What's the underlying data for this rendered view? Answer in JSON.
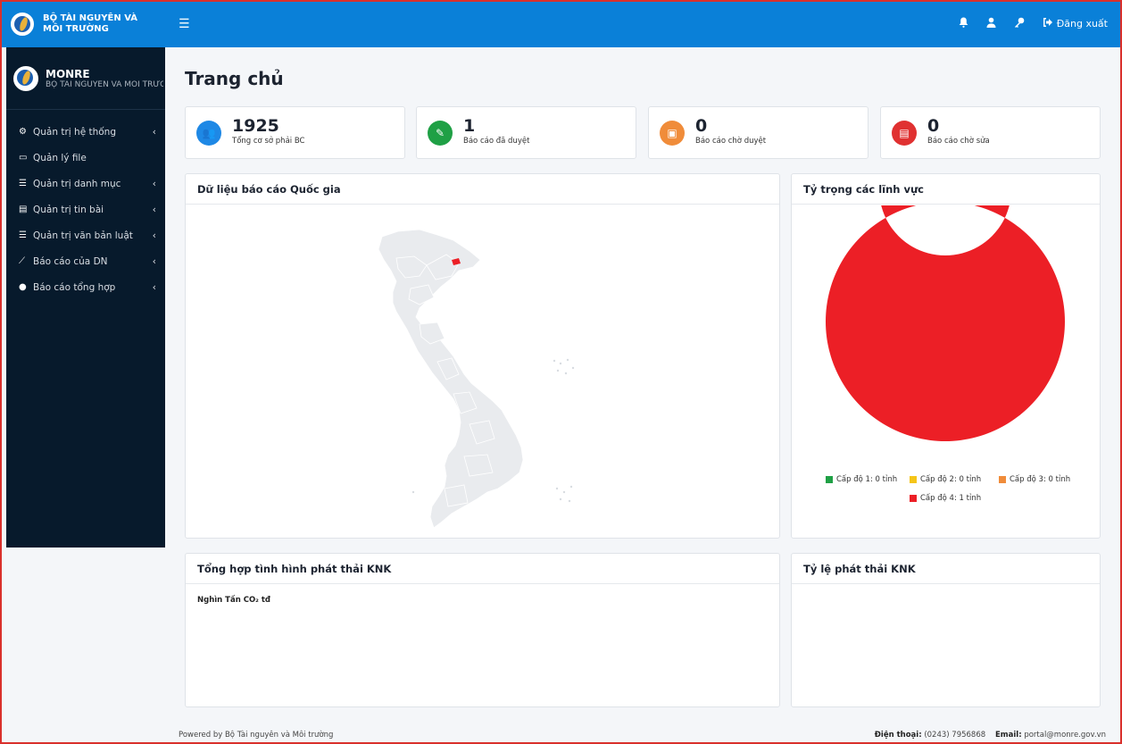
{
  "topbar": {
    "brand": "BỘ TÀI NGUYÊN VÀ MÔI TRƯỜNG",
    "menu_icon": "hamburger-icon",
    "logout_label": "Đăng xuất",
    "accent_color": "#0a80d8"
  },
  "sidebar": {
    "name": "MONRE",
    "subtitle": "BỘ TÀI NGUYÊN VÀ MÔI TRƯỜNG",
    "items": [
      {
        "label": "Quản trị hệ thống",
        "icon": "cogs-icon",
        "glyph": "⚙",
        "submenu": true
      },
      {
        "label": "Quản lý file",
        "icon": "folder-icon",
        "glyph": "▭",
        "submenu": false
      },
      {
        "label": "Quản trị danh mục",
        "icon": "list-icon",
        "glyph": "☰",
        "submenu": true
      },
      {
        "label": "Quản trị tin bài",
        "icon": "newspaper-icon",
        "glyph": "▤",
        "submenu": true
      },
      {
        "label": "Quản trị văn bản luật",
        "icon": "list-icon",
        "glyph": "☰",
        "submenu": true
      },
      {
        "label": "Báo cáo của DN",
        "icon": "line-chart-icon",
        "glyph": "⟋",
        "submenu": true
      },
      {
        "label": "Báo cáo tổng hợp",
        "icon": "pie-chart-icon",
        "glyph": "●",
        "submenu": true
      }
    ],
    "chevron": "‹"
  },
  "main": {
    "title": "Trang chủ",
    "stats": [
      {
        "value": "1925",
        "label": "Tổng cơ sở phải BC",
        "color": "#1e88e5",
        "icon": "users-icon",
        "glyph": "👥"
      },
      {
        "value": "1",
        "label": "Báo cáo đã duyệt",
        "color": "#1fa045",
        "icon": "check-file-icon",
        "glyph": "✎"
      },
      {
        "value": "0",
        "label": "Báo cáo chờ duyệt",
        "color": "#f08c3a",
        "icon": "pending-file-icon",
        "glyph": "▣"
      },
      {
        "value": "0",
        "label": "Báo cáo chờ sửa",
        "color": "#e03131",
        "icon": "edit-file-icon",
        "glyph": "▤"
      }
    ],
    "map_card": {
      "title": "Dữ liệu báo cáo Quốc gia"
    },
    "ratio_card": {
      "title": "Tỷ trọng các lĩnh vực"
    },
    "emission_card": {
      "title": "Tổng hợp tình hình phát thải KNK",
      "unit_label": "Nghìn Tấn CO₂ tđ"
    },
    "emission_ratio_card": {
      "title": "Tỷ lệ phát thải KNK"
    }
  },
  "chart_data": {
    "type": "pie",
    "style": "donut",
    "title": "Tỷ trọng các lĩnh vực",
    "legend_placement": "bottom",
    "series": [
      {
        "name": "Cấp độ 1: 0 tỉnh",
        "value": 0,
        "color": "#1fa045"
      },
      {
        "name": "Cấp độ 2: 0 tỉnh",
        "value": 0,
        "color": "#f5c518"
      },
      {
        "name": "Cấp độ 3: 0 tỉnh",
        "value": 0,
        "color": "#f08c3a"
      },
      {
        "name": "Cấp độ 4: 1 tỉnh",
        "value": 1,
        "color": "#ec1f26"
      }
    ]
  },
  "footer": {
    "left": "Powered by Bộ Tài nguyên và Môi trường",
    "phone_label": "Điện thoại:",
    "phone": "(0243) 7956868",
    "email_label": "Email:",
    "email": "portal@monre.gov.vn"
  }
}
